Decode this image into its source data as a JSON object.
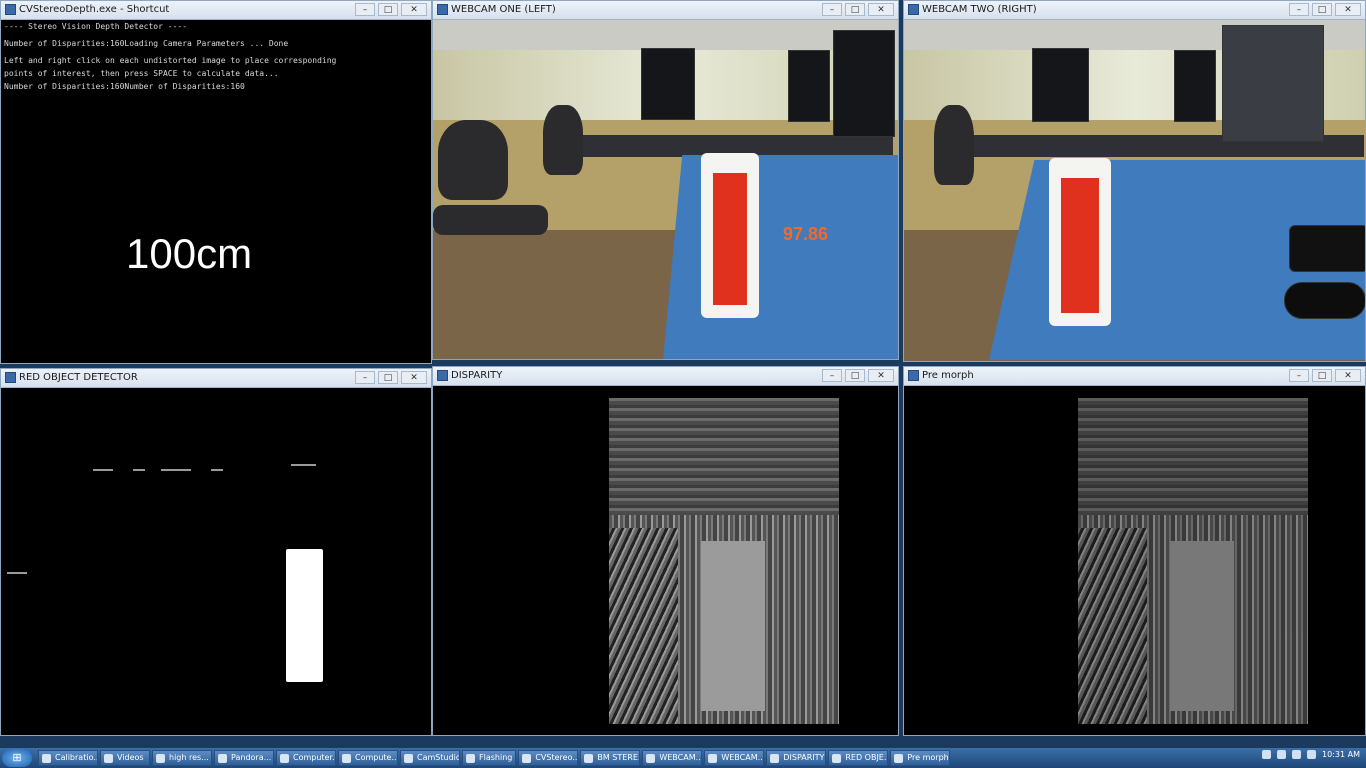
{
  "windows": {
    "console": {
      "title": "CVStereoDepth.exe - Shortcut",
      "lines": [
        "---- Stereo Vision Depth Detector ----",
        "",
        "Number of Disparities:160Loading Camera Parameters ... Done",
        "",
        "Left and right click on each undistorted image to place corresponding",
        "points of interest, then press SPACE to calculate data...",
        "Number of Disparities:160Number of Disparities:160"
      ],
      "distance_text": "100cm"
    },
    "webcam_left": {
      "title": "WEBCAM ONE (LEFT)",
      "readout": "97.86"
    },
    "webcam_right": {
      "title": "WEBCAM TWO (RIGHT)"
    },
    "red_object": {
      "title": "RED OBJECT DETECTOR"
    },
    "disparity": {
      "title": "DISPARITY"
    },
    "pre_morph": {
      "title": "Pre morph"
    }
  },
  "window_controls": {
    "minimize": "–",
    "maximize": "□",
    "close": "✕"
  },
  "taskbar": {
    "start_icon": "windows-logo-icon",
    "items": [
      "Calibratio...",
      "Videos",
      "high res...",
      "Pandora...",
      "Computer...",
      "Compute...",
      "CamStudio",
      "Flashing",
      "CVStereo...",
      "BM STERE...",
      "WEBCAM...",
      "WEBCAM...",
      "DISPARITY",
      "RED OBJE...",
      "Pre morph"
    ],
    "clock": "10:31 AM"
  }
}
